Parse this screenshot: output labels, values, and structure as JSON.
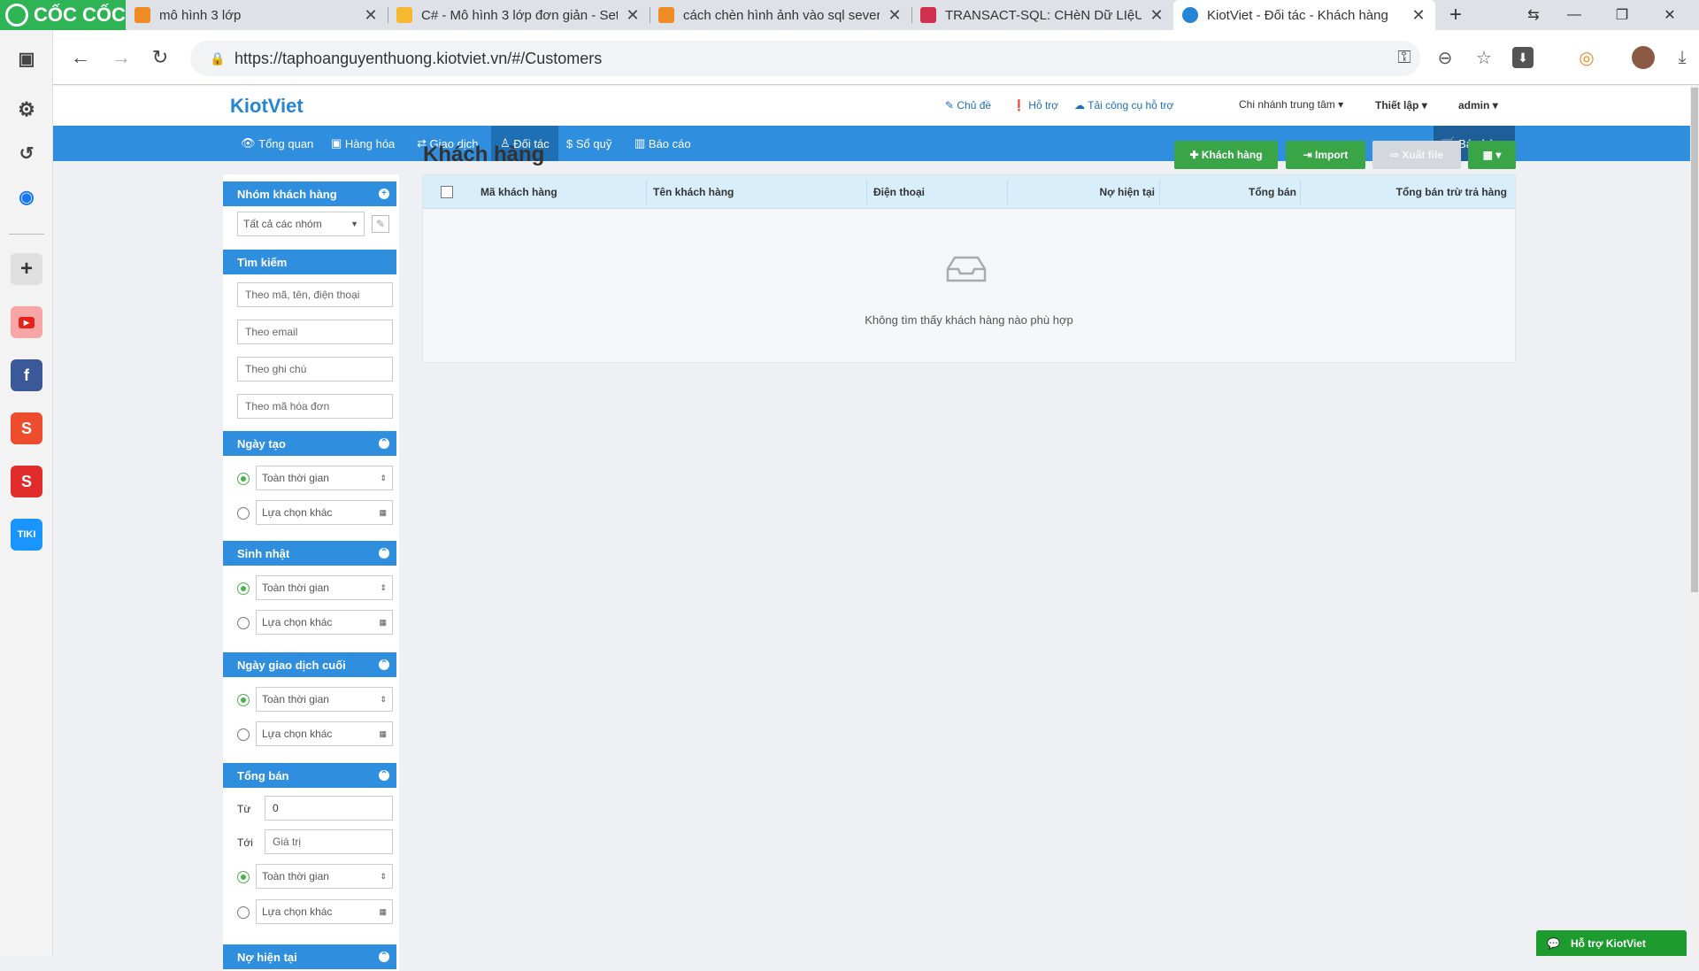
{
  "browser": {
    "brand": "CỐC CỐC",
    "tabs": [
      {
        "label": "mô hình 3 lớp",
        "color": "#f08a24"
      },
      {
        "label": "C# - Mô hình 3 lớp đơn giản - Set",
        "color": "#f7b731"
      },
      {
        "label": "cách chèn hình ảnh vào sql sever",
        "color": "#f08a24"
      },
      {
        "label": "TRANSACT-SQL: CHèN Dữ LIệU H",
        "color": "#d0314f"
      },
      {
        "label": "KiotViet - Đối tác - Khách hàng",
        "color": "#2486d6"
      }
    ],
    "new_tab": "+",
    "url": "https://taphoanguyenthuong.kiotviet.vn/#/Customers"
  },
  "header": {
    "logo": "KiotViet",
    "links": {
      "theme": "Chủ đề",
      "support": "Hỗ trợ",
      "download": "Tải công cụ hỗ trợ"
    },
    "branch": "Chi nhánh trung tâm",
    "settings": "Thiết lập",
    "user": "admin"
  },
  "nav": {
    "items": [
      "Tổng quan",
      "Hàng hóa",
      "Giao dịch",
      "Đối tác",
      "Sổ quỹ",
      "Báo cáo"
    ],
    "sell": "Bán hàng"
  },
  "filters": {
    "group_title": "Nhóm khách hàng",
    "group_select": "Tất cả các nhóm",
    "search_title": "Tìm kiếm",
    "search_placeholders": [
      "Theo mã, tên, điện thoại",
      "Theo email",
      "Theo ghi chú",
      "Theo mã hóa đơn"
    ],
    "created_title": "Ngày tạo",
    "birthday_title": "Sinh nhật",
    "last_tx_title": "Ngày giao dịch cuối",
    "total_sales_title": "Tổng bán",
    "all_time": "Toàn thời gian",
    "other_choice": "Lựa chọn khác",
    "from_label": "Từ",
    "to_label": "Tới",
    "from_value": "0",
    "to_placeholder": "Giá trị",
    "debt_title": "Nợ hiện tại"
  },
  "main": {
    "title": "Khách hàng",
    "buttons": {
      "add": "Khách hàng",
      "import": "Import",
      "export": "Xuất file"
    },
    "columns": [
      "Mã khách hàng",
      "Tên khách hàng",
      "Điện thoại",
      "Nợ hiện tại",
      "Tổng bán",
      "Tổng bán trừ trả hàng"
    ],
    "empty_message": "Không tìm thấy khách hàng nào phù hợp"
  },
  "support_widget": "Hỗ trợ KiotViet",
  "colors": {
    "primary": "#2f8fde",
    "green": "#3aa547",
    "coccoc_green": "#2fb455"
  }
}
